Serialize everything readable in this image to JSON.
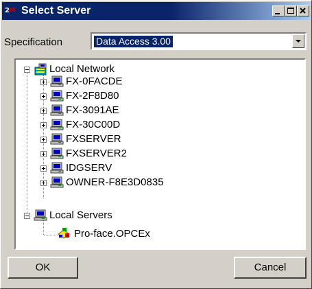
{
  "window": {
    "title": "Select Server",
    "icon_text": "2",
    "icon_text_red": "M"
  },
  "title_buttons": [
    "minimize-icon",
    "maximize-icon",
    "close-icon"
  ],
  "specification": {
    "label": "Specification",
    "value": "Data Access 3.00"
  },
  "tree": {
    "local_network": {
      "label": "Local Network",
      "children": [
        "FX-0FACDE",
        "FX-2F8D80",
        "FX-3091AE",
        "FX-30C00D",
        "FXSERVER",
        "FXSERVER2",
        "IDGSERV",
        "OWNER-F8E3D0835"
      ]
    },
    "local_servers": {
      "label": "Local Servers",
      "children": [
        "Pro-face.OPCEx"
      ]
    }
  },
  "buttons": {
    "ok": "OK",
    "cancel": "Cancel"
  }
}
